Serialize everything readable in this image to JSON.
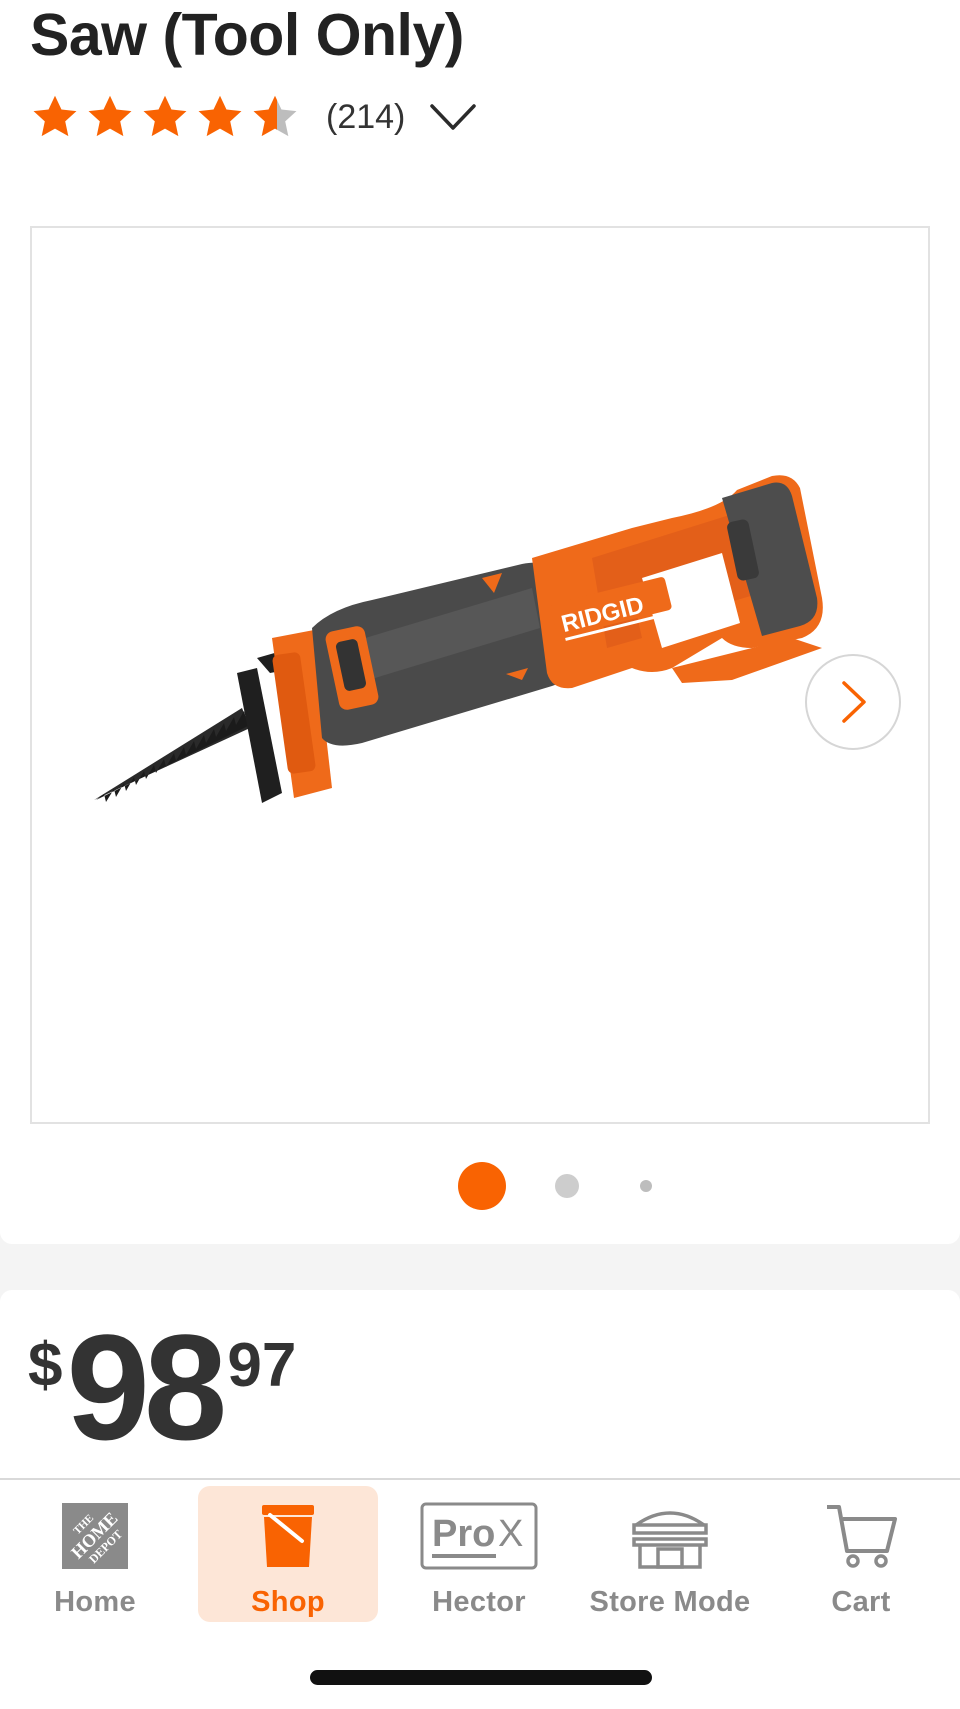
{
  "product": {
    "title": "Saw (Tool Only)",
    "rating": 4.5,
    "review_count": "(214)",
    "price": {
      "currency": "$",
      "dollars": "98",
      "cents": "97"
    },
    "image": {
      "brand_mark": "RIDGID",
      "current_slide": 1,
      "total_slides": 3
    }
  },
  "icons": {
    "rating_toggle": "chevron-down-icon",
    "next_image": "chevron-right-icon"
  },
  "bottom_nav": {
    "items": [
      {
        "label": "Home",
        "icon": "home-depot-logo-icon",
        "active": false
      },
      {
        "label": "Shop",
        "icon": "bucket-icon",
        "active": true
      },
      {
        "label": "Hector",
        "icon": "prox-icon",
        "active": false
      },
      {
        "label": "Store Mode",
        "icon": "store-icon",
        "active": false
      },
      {
        "label": "Cart",
        "icon": "cart-icon",
        "active": false
      }
    ]
  },
  "colors": {
    "accent": "#f96302",
    "star_empty": "#bdbdbd",
    "nav_active_bg": "#fde6d7",
    "nav_inactive": "#8a8a8a"
  }
}
